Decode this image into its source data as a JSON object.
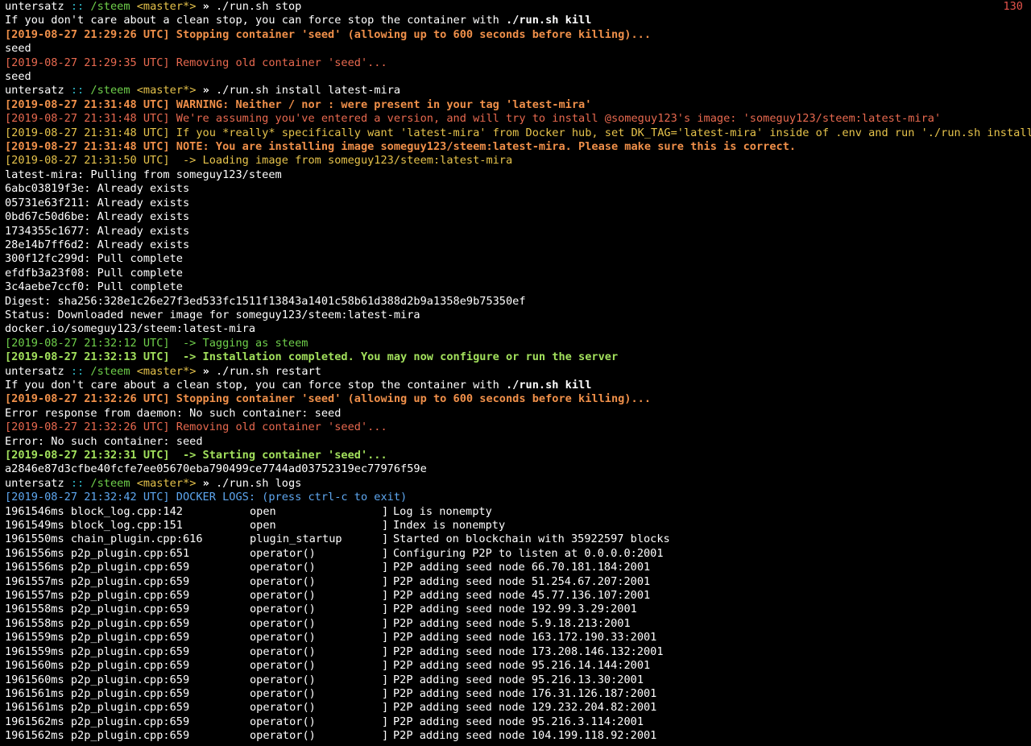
{
  "terminal": {
    "exit_code": "130",
    "prompt": {
      "user": "untersatz",
      "sep": "::",
      "path": "/steem",
      "branch": "<master*>",
      "arrow": "»"
    },
    "commands": {
      "stop": "./run.sh stop",
      "install": "./run.sh install latest-mira",
      "restart": "./run.sh restart",
      "logs": "./run.sh logs"
    },
    "stop_block": {
      "force_prefix": "If you don't care about a clean stop, you can force stop the container with ",
      "force_cmd": "./run.sh kill",
      "stopping": "[2019-08-27 21:29:26 UTC] Stopping container 'seed' (allowing up to 600 seconds before killing)...",
      "seed1": "seed",
      "removing": "[2019-08-27 21:29:35 UTC] Removing old container 'seed'...",
      "seed2": "seed"
    },
    "install_block": {
      "warning": "[2019-08-27 21:31:48 UTC] WARNING: Neither / nor : were present in your tag 'latest-mira'",
      "assuming": "[2019-08-27 21:31:48 UTC] We're assuming you've entered a version, and will try to install @someguy123's image: 'someguy123/steem:latest-mira'",
      "really": "[2019-08-27 21:31:48 UTC] If you *really* specifically want 'latest-mira' from Docker hub, set DK_TAG='latest-mira' inside of .env and run './run.sh install'",
      "note": "[2019-08-27 21:31:48 UTC] NOTE: You are installing image someguy123/steem:latest-mira. Please make sure this is correct.",
      "loading": "[2019-08-27 21:31:50 UTC]  -> Loading image from someguy123/steem:latest-mira",
      "pulling": "latest-mira: Pulling from someguy123/steem",
      "layers": [
        "6abc03819f3e: Already exists",
        "05731e63f211: Already exists",
        "0bd67c50d6be: Already exists",
        "1734355c1677: Already exists",
        "28e14b7ff6d2: Already exists",
        "300f12fc299d: Pull complete",
        "efdfb3a23f08: Pull complete",
        "3c4aebe7ccf0: Pull complete"
      ],
      "digest": "Digest: sha256:328e1c26e27f3ed533fc1511f13843a1401c58b61d388d2b9a1358e9b75350ef",
      "status": "Status: Downloaded newer image for someguy123/steem:latest-mira",
      "image": "docker.io/someguy123/steem:latest-mira",
      "tagging": "[2019-08-27 21:32:12 UTC]  -> Tagging as steem",
      "completed": "[2019-08-27 21:32:13 UTC]  -> Installation completed. You may now configure or run the server"
    },
    "restart_block": {
      "force_prefix": "If you don't care about a clean stop, you can force stop the container with ",
      "force_cmd": "./run.sh kill",
      "stopping": "[2019-08-27 21:32:26 UTC] Stopping container 'seed' (allowing up to 600 seconds before killing)...",
      "error1": "Error response from daemon: No such container: seed",
      "removing": "[2019-08-27 21:32:26 UTC] Removing old container 'seed'...",
      "error2": "Error: No such container: seed",
      "starting": "[2019-08-27 21:32:31 UTC]  -> Starting container 'seed'...",
      "container_id": "a2846e87d3cfbe40fcfe7ee05670eba790499ce7744ad03752319ec77976f59e"
    },
    "logs_block": {
      "header": "[2019-08-27 21:32:42 UTC] DOCKER LOGS: (press ctrl-c to exit)",
      "rows": [
        {
          "src": "1961546ms block_log.cpp:142",
          "fn": "open",
          "msg": "Log is nonempty"
        },
        {
          "src": "1961549ms block_log.cpp:151",
          "fn": "open",
          "msg": "Index is nonempty"
        },
        {
          "src": "1961550ms chain_plugin.cpp:616",
          "fn": "plugin_startup",
          "msg": "Started on blockchain with 35922597 blocks"
        },
        {
          "src": "1961556ms p2p_plugin.cpp:651",
          "fn": "operator()",
          "msg": "Configuring P2P to listen at 0.0.0.0:2001"
        },
        {
          "src": "1961556ms p2p_plugin.cpp:659",
          "fn": "operator()",
          "msg": "P2P adding seed node 66.70.181.184:2001"
        },
        {
          "src": "1961557ms p2p_plugin.cpp:659",
          "fn": "operator()",
          "msg": "P2P adding seed node 51.254.67.207:2001"
        },
        {
          "src": "1961557ms p2p_plugin.cpp:659",
          "fn": "operator()",
          "msg": "P2P adding seed node 45.77.136.107:2001"
        },
        {
          "src": "1961558ms p2p_plugin.cpp:659",
          "fn": "operator()",
          "msg": "P2P adding seed node 192.99.3.29:2001"
        },
        {
          "src": "1961558ms p2p_plugin.cpp:659",
          "fn": "operator()",
          "msg": "P2P adding seed node 5.9.18.213:2001"
        },
        {
          "src": "1961559ms p2p_plugin.cpp:659",
          "fn": "operator()",
          "msg": "P2P adding seed node 163.172.190.33:2001"
        },
        {
          "src": "1961559ms p2p_plugin.cpp:659",
          "fn": "operator()",
          "msg": "P2P adding seed node 173.208.146.132:2001"
        },
        {
          "src": "1961560ms p2p_plugin.cpp:659",
          "fn": "operator()",
          "msg": "P2P adding seed node 95.216.14.144:2001"
        },
        {
          "src": "1961560ms p2p_plugin.cpp:659",
          "fn": "operator()",
          "msg": "P2P adding seed node 95.216.13.30:2001"
        },
        {
          "src": "1961561ms p2p_plugin.cpp:659",
          "fn": "operator()",
          "msg": "P2P adding seed node 176.31.126.187:2001"
        },
        {
          "src": "1961561ms p2p_plugin.cpp:659",
          "fn": "operator()",
          "msg": "P2P adding seed node 129.232.204.82:2001"
        },
        {
          "src": "1961562ms p2p_plugin.cpp:659",
          "fn": "operator()",
          "msg": "P2P adding seed node 95.216.3.114:2001"
        },
        {
          "src": "1961562ms p2p_plugin.cpp:659",
          "fn": "operator()",
          "msg": "P2P adding seed node 104.199.118.92:2001"
        }
      ]
    }
  }
}
